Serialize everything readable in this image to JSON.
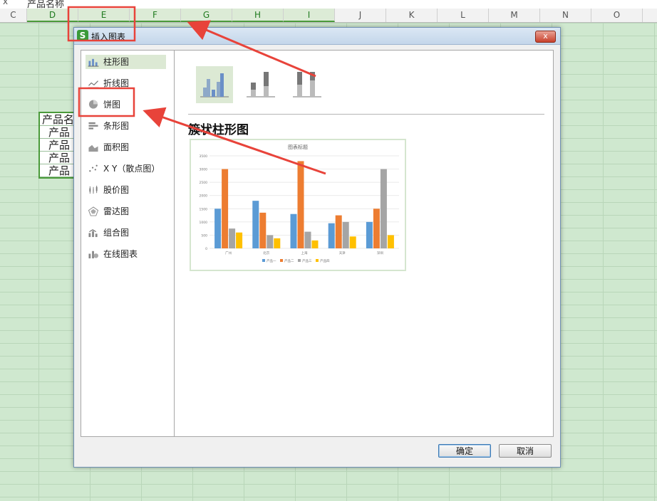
{
  "formula_bar": {
    "x_label": "x",
    "content": "产品名称"
  },
  "columns": [
    "C",
    "D",
    "E",
    "F",
    "G",
    "H",
    "I",
    "J",
    "K",
    "L",
    "M",
    "N",
    "O"
  ],
  "cells": [
    "产品名",
    "产品",
    "产品",
    "产品",
    "产品"
  ],
  "dialog": {
    "title": "插入图表",
    "close_label": "x",
    "categories": [
      {
        "label": "柱形图",
        "icon": "column-chart-icon"
      },
      {
        "label": "折线图",
        "icon": "line-chart-icon"
      },
      {
        "label": "饼图",
        "icon": "pie-chart-icon"
      },
      {
        "label": "条形图",
        "icon": "bar-chart-icon"
      },
      {
        "label": "面积图",
        "icon": "area-chart-icon"
      },
      {
        "label": "X Y（散点图）",
        "icon": "scatter-chart-icon"
      },
      {
        "label": "股价图",
        "icon": "stock-chart-icon"
      },
      {
        "label": "雷达图",
        "icon": "radar-chart-icon"
      },
      {
        "label": "组合图",
        "icon": "combo-chart-icon"
      },
      {
        "label": "在线图表",
        "icon": "online-chart-icon"
      }
    ],
    "selected_category": 0,
    "subtypes": [
      "clustered-column-icon",
      "stacked-column-icon",
      "percent-stacked-column-icon"
    ],
    "selected_subtype": 0,
    "chart_name": "簇状柱形图",
    "ok_label": "确定",
    "cancel_label": "取消"
  },
  "chart_data": {
    "type": "bar",
    "title": "图表标题",
    "categories": [
      "广州",
      "北京",
      "上海",
      "天津",
      "深圳"
    ],
    "series": [
      {
        "name": "产品一",
        "values": [
          1500,
          1800,
          1300,
          950,
          1000
        ],
        "color": "#5b9bd5"
      },
      {
        "name": "产品二",
        "values": [
          3000,
          1350,
          3300,
          1250,
          1500
        ],
        "color": "#ed7d31"
      },
      {
        "name": "产品三",
        "values": [
          750,
          500,
          630,
          1000,
          3000
        ],
        "color": "#a5a5a5"
      },
      {
        "name": "产品四",
        "values": [
          600,
          380,
          300,
          450,
          500
        ],
        "color": "#ffc000"
      }
    ],
    "ylim": [
      0,
      3500
    ],
    "yticks": [
      0,
      500,
      1000,
      1500,
      2000,
      2500,
      3000,
      3500
    ],
    "grid": true,
    "legend": "bottom"
  },
  "colors": {
    "annotation": "#e8433a",
    "selection": "#4a9a3a",
    "active_bg": "#dce9d4"
  }
}
